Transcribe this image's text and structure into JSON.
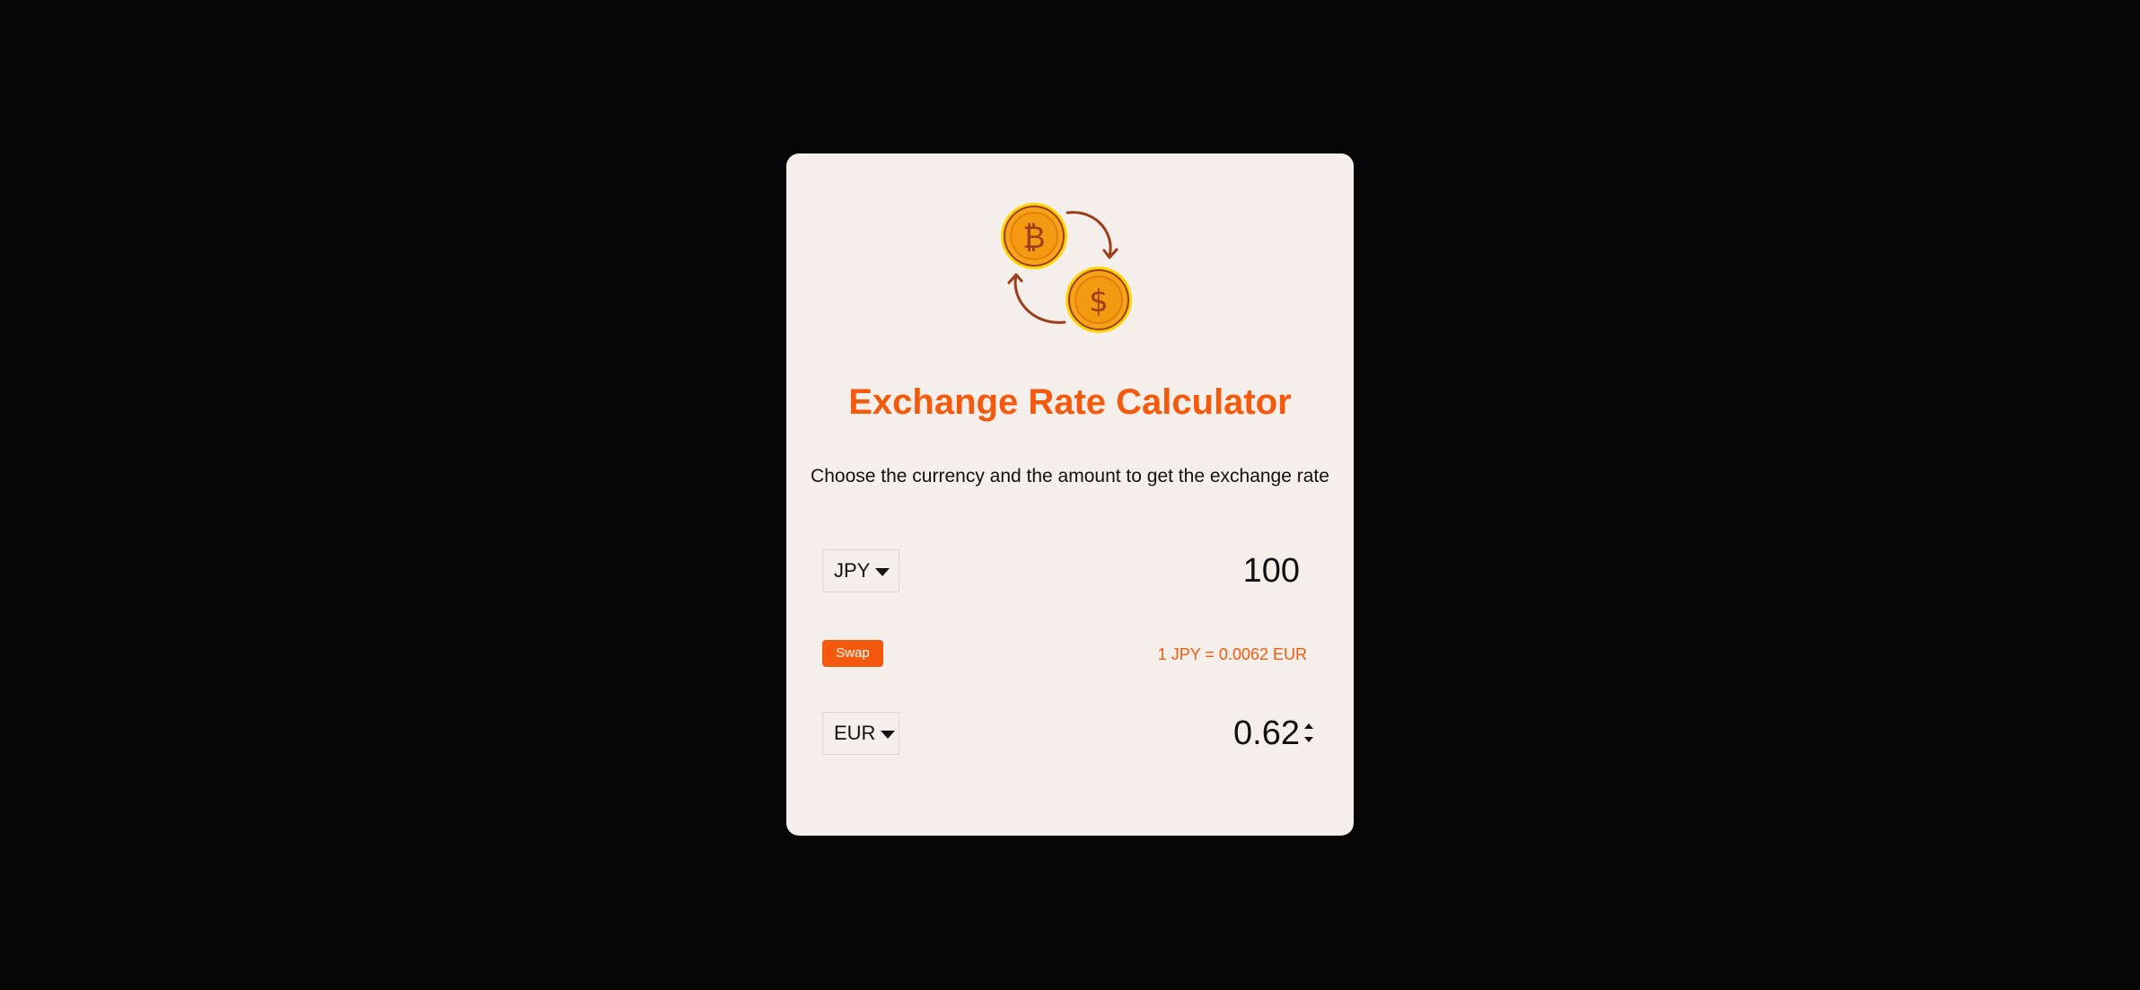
{
  "app": {
    "title": "Exchange Rate Calculator",
    "subtitle": "Choose the currency and the amount to get the exchange rate"
  },
  "logo": {
    "icon": "coins-exchange-icon",
    "coin_one_symbol": "₿",
    "coin_two_symbol": "$"
  },
  "currency_one": {
    "selected": "JPY",
    "amount": "100"
  },
  "currency_two": {
    "selected": "EUR",
    "amount": "0.62"
  },
  "swap": {
    "label": "Swap"
  },
  "rate": {
    "text": "1 JPY = 0.0062 EUR"
  },
  "colors": {
    "background": "#060606",
    "card": "#f4efea",
    "accent": "#f35a0d",
    "coin": "#f7a21b",
    "coin_rim": "#ffd400",
    "arrow": "#9b3f1b"
  }
}
